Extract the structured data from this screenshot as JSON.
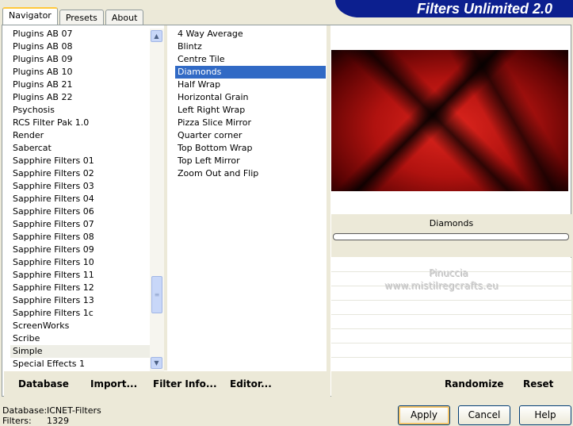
{
  "tabs": [
    "Navigator",
    "Presets",
    "About"
  ],
  "banner_title": "Filters Unlimited 2.0",
  "categories": [
    "Plugins AB 07",
    "Plugins AB 08",
    "Plugins AB 09",
    "Plugins AB 10",
    "Plugins AB 21",
    "Plugins AB 22",
    "Psychosis",
    "RCS Filter Pak 1.0",
    "Render",
    "Sabercat",
    "Sapphire Filters 01",
    "Sapphire Filters 02",
    "Sapphire Filters 03",
    "Sapphire Filters 04",
    "Sapphire Filters 06",
    "Sapphire Filters 07",
    "Sapphire Filters 08",
    "Sapphire Filters 09",
    "Sapphire Filters 10",
    "Sapphire Filters 11",
    "Sapphire Filters 12",
    "Sapphire Filters 13",
    "Sapphire Filters 1c",
    "ScreenWorks",
    "Scribe",
    "Simple",
    "Special Effects 1"
  ],
  "selected_category": "Simple",
  "filters": [
    "4 Way Average",
    "Blintz",
    "Centre Tile",
    "Diamonds",
    "Half Wrap",
    "Horizontal Grain",
    "Left Right Wrap",
    "Pizza Slice Mirror",
    "Quarter corner",
    "Top Bottom Wrap",
    "Top Left Mirror",
    "Zoom Out and Flip"
  ],
  "selected_filter": "Diamonds",
  "param_label": "Diamonds",
  "watermark": {
    "line1": "Pinuccia",
    "line2": "www.mistilregcrafts.eu"
  },
  "toolbar_left": {
    "database": "Database",
    "import": "Import...",
    "filter_info": "Filter Info...",
    "editor": "Editor..."
  },
  "toolbar_right": {
    "randomize": "Randomize",
    "reset": "Reset"
  },
  "status": {
    "database_label": "Database:",
    "database_value": "ICNET-Filters",
    "filters_label": "Filters:",
    "filters_value": "1329"
  },
  "buttons": {
    "apply": "Apply",
    "cancel": "Cancel",
    "help": "Help"
  },
  "colors": {
    "selection": "#316ac5",
    "banner": "#0c1f8f"
  },
  "icons": {
    "scroll_up": "chevron-up-icon",
    "scroll_down": "chevron-down-icon"
  }
}
